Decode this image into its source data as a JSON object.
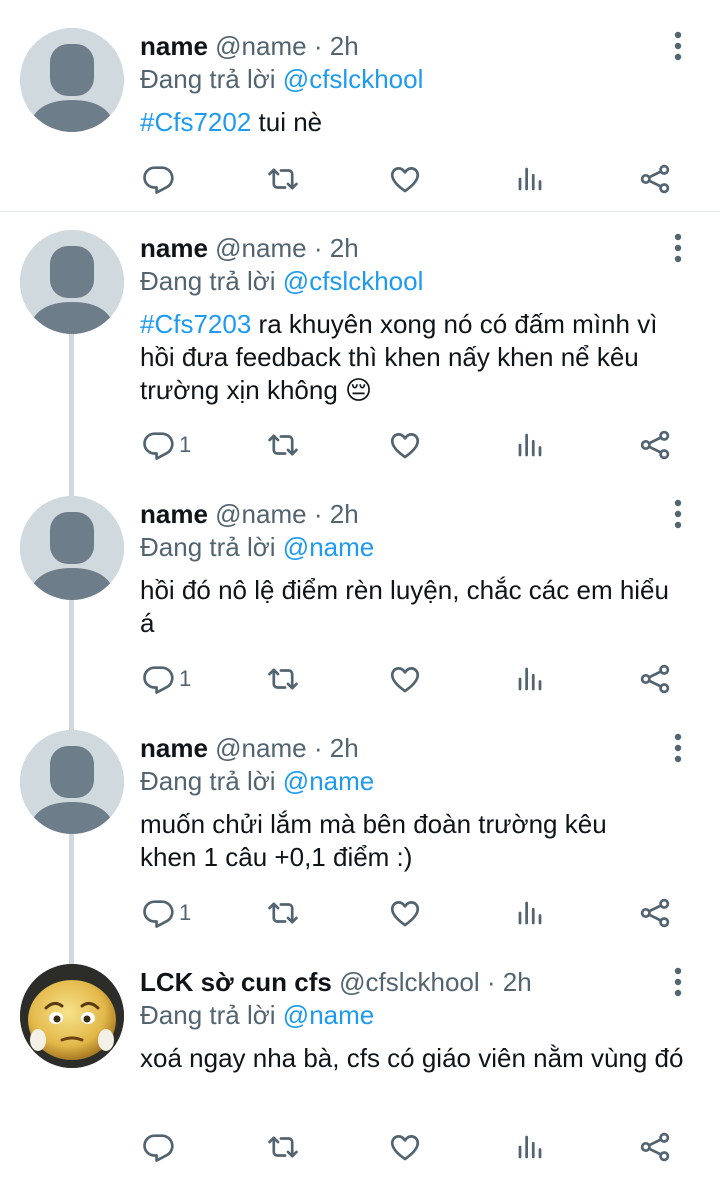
{
  "tweets": [
    {
      "display_name": "name",
      "handle": "@name",
      "dot": "·",
      "time": "2h",
      "replying_label": "Đang trả lời",
      "replying_to": "@cfslckhool",
      "hashtag": "#Cfs7202",
      "text": " tui nè",
      "reply_count": "",
      "avatar_type": "default"
    },
    {
      "display_name": "name",
      "handle": "@name",
      "dot": "·",
      "time": "2h",
      "replying_label": "Đang trả lời",
      "replying_to": "@cfslckhool",
      "hashtag": "#Cfs7203",
      "text": " ra khuyên xong nó có đấm mình vì hồi đưa feedback thì khen nấy khen nể kêu trường xịn không 😔",
      "reply_count": "1",
      "avatar_type": "default"
    },
    {
      "display_name": "name",
      "handle": "@name",
      "dot": "·",
      "time": "2h",
      "replying_label": "Đang trả lời",
      "replying_to": "@name",
      "hashtag": "",
      "text": "hồi đó nô lệ điểm rèn luyện, chắc các em hiểu á",
      "reply_count": "1",
      "avatar_type": "default"
    },
    {
      "display_name": "name",
      "handle": "@name",
      "dot": "·",
      "time": "2h",
      "replying_label": "Đang trả lời",
      "replying_to": "@name",
      "hashtag": "",
      "text": "muốn chửi lắm mà bên đoàn trường kêu khen 1 câu +0,1 điểm :)",
      "reply_count": "1",
      "avatar_type": "default"
    },
    {
      "display_name": "LCK sờ cun cfs",
      "handle": "@cfslckhool",
      "dot": "·",
      "time": "2h",
      "replying_label": "Đang trả lời",
      "replying_to": "@name",
      "hashtag": "",
      "text": "xoá ngay nha bà, cfs có giáo viên nằm vùng đó",
      "reply_count": "",
      "avatar_type": "emoji-face"
    }
  ],
  "icons": {
    "reply": "reply-icon",
    "retweet": "retweet-icon",
    "like": "heart-icon",
    "views": "analytics-icon",
    "share": "share-icon",
    "more": "more-icon"
  },
  "colors": {
    "link": "#1d9bf0",
    "secondary": "#536471",
    "primary": "#0f1419",
    "avatar_bg": "#cfd9de",
    "avatar_fg": "#6e7d8a",
    "thread_line": "#cfd9de"
  }
}
